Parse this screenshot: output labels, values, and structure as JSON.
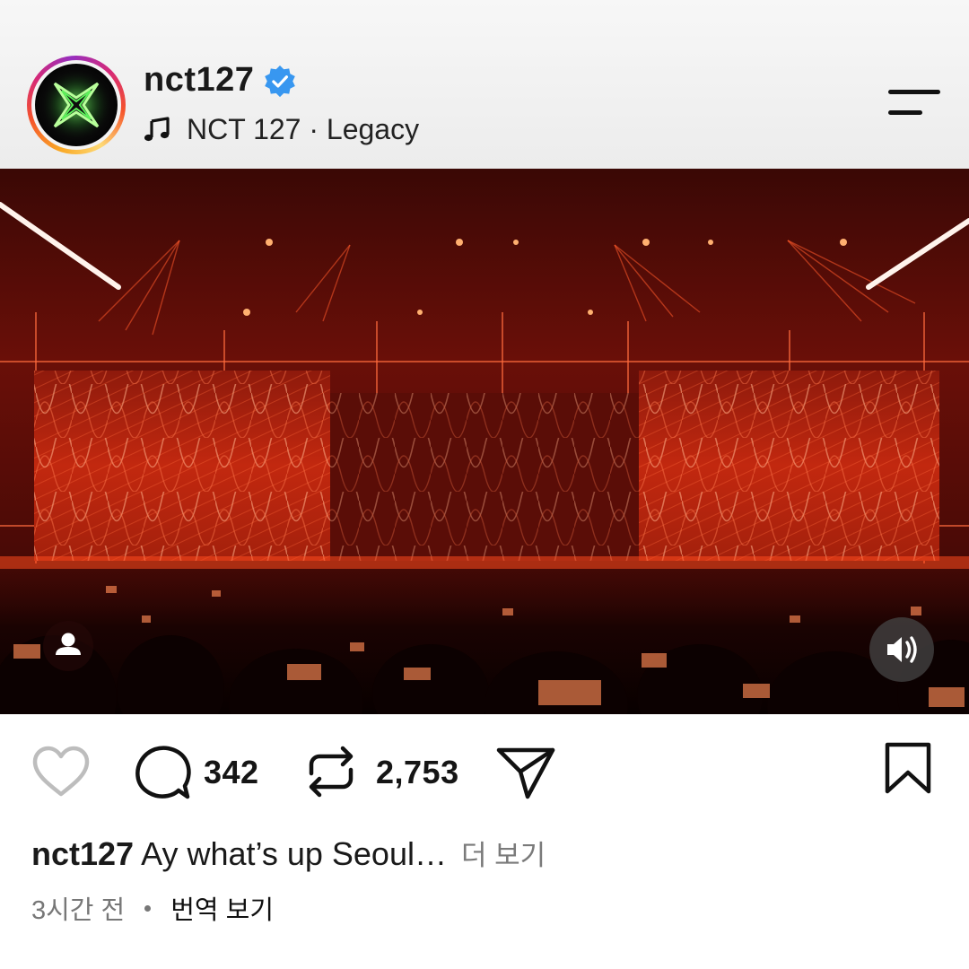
{
  "post": {
    "username": "nct127",
    "verified": true,
    "music": {
      "icon": "music-note-icon",
      "text": "NCT 127 · Legacy"
    },
    "menu_icon": "menu-icon"
  },
  "media": {
    "type": "video",
    "description_icon_user": "user-tag-icon",
    "audio_icon": "speaker-icon"
  },
  "actions": {
    "like_icon": "heart-icon",
    "comment_icon": "comment-icon",
    "comment_count": "342",
    "repost_icon": "repost-icon",
    "repost_count": "2,753",
    "share_icon": "share-icon",
    "save_icon": "bookmark-icon"
  },
  "caption": {
    "username": "nct127",
    "text": "Ay what’s up Seoul…",
    "more_label": "더 보기"
  },
  "meta": {
    "time": "3시간 전",
    "translate_label": "번역 보기"
  },
  "colors": {
    "stage_red": "#c2200e",
    "verified_blue": "#3897f0",
    "text": "#1a1a1a",
    "muted": "#777777"
  }
}
